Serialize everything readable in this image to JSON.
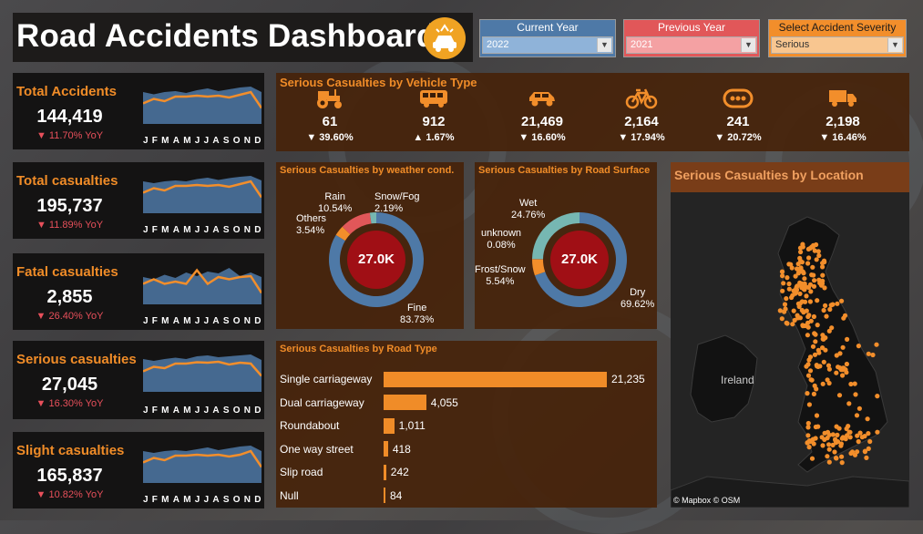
{
  "header": {
    "title": "Road Accidents Dashboard",
    "icon": "car-crash-icon"
  },
  "filters": {
    "current_year": {
      "label": "Current Year",
      "value": "2022",
      "color": "#4e79a7"
    },
    "previous_year": {
      "label": "Previous Year",
      "value": "2021",
      "color": "#e15759"
    },
    "severity": {
      "label": "Select Accident Severity",
      "value": "Serious",
      "color": "#f28e2b"
    }
  },
  "months": [
    "J",
    "F",
    "M",
    "A",
    "M",
    "J",
    "J",
    "A",
    "S",
    "O",
    "N",
    "D"
  ],
  "kpis": [
    {
      "name": "Total Accidents",
      "value": "144,419",
      "yoy": "▼ 11.70% YoY",
      "current": [
        0.45,
        0.55,
        0.5,
        0.6,
        0.6,
        0.62,
        0.6,
        0.62,
        0.58,
        0.64,
        0.7,
        0.35
      ],
      "previous": [
        0.7,
        0.65,
        0.7,
        0.72,
        0.68,
        0.74,
        0.78,
        0.72,
        0.76,
        0.8,
        0.82,
        0.7
      ]
    },
    {
      "name": "Total casualties",
      "value": "195,737",
      "yoy": "▼ 11.89% YoY",
      "current": [
        0.45,
        0.55,
        0.5,
        0.6,
        0.6,
        0.62,
        0.6,
        0.62,
        0.58,
        0.64,
        0.7,
        0.35
      ],
      "previous": [
        0.7,
        0.66,
        0.7,
        0.72,
        0.7,
        0.75,
        0.78,
        0.73,
        0.77,
        0.8,
        0.82,
        0.72
      ]
    },
    {
      "name": "Fatal casualties",
      "value": "2,855",
      "yoy": "▼ 26.40% YoY",
      "current": [
        0.45,
        0.55,
        0.45,
        0.5,
        0.45,
        0.75,
        0.45,
        0.6,
        0.55,
        0.6,
        0.62,
        0.25
      ],
      "previous": [
        0.6,
        0.55,
        0.65,
        0.58,
        0.7,
        0.62,
        0.72,
        0.68,
        0.8,
        0.62,
        0.7,
        0.6
      ]
    },
    {
      "name": "Serious casualties",
      "value": "27,045",
      "yoy": "▼ 16.30% YoY",
      "current": [
        0.45,
        0.55,
        0.52,
        0.62,
        0.62,
        0.65,
        0.64,
        0.66,
        0.6,
        0.64,
        0.62,
        0.35
      ],
      "previous": [
        0.72,
        0.68,
        0.72,
        0.75,
        0.72,
        0.78,
        0.8,
        0.76,
        0.78,
        0.8,
        0.82,
        0.7
      ]
    },
    {
      "name": "Slight casualties",
      "value": "165,837",
      "yoy": "▼ 10.82% YoY",
      "current": [
        0.45,
        0.55,
        0.5,
        0.6,
        0.6,
        0.62,
        0.6,
        0.62,
        0.58,
        0.62,
        0.7,
        0.35
      ],
      "previous": [
        0.7,
        0.66,
        0.7,
        0.72,
        0.7,
        0.74,
        0.78,
        0.72,
        0.76,
        0.8,
        0.82,
        0.7
      ]
    }
  ],
  "vehicle_panel": {
    "title": "Serious Casualties by Vehicle Type",
    "items": [
      {
        "icon": "tractor-icon",
        "value": "61",
        "change": "▼ 39.60%"
      },
      {
        "icon": "bus-icon",
        "value": "912",
        "change": "▲ 1.67%"
      },
      {
        "icon": "car-icon",
        "value": "21,469",
        "change": "▼ 16.60%"
      },
      {
        "icon": "bicycle-icon",
        "value": "2,164",
        "change": "▼ 17.94%"
      },
      {
        "icon": "other-vehicle-icon",
        "value": "241",
        "change": "▼ 20.72%"
      },
      {
        "icon": "truck-icon",
        "value": "2,198",
        "change": "▼ 16.46%"
      }
    ]
  },
  "weather_panel": {
    "title": "Serious Casualties by weather cond.",
    "center": "27.0K",
    "labels": {
      "rain": [
        "Rain",
        "10.54%"
      ],
      "snow": [
        "Snow/Fog",
        "2.19%"
      ],
      "others": [
        "Others",
        "3.54%"
      ],
      "fine": [
        "Fine",
        "83.73%"
      ]
    }
  },
  "surface_panel": {
    "title": "Serious Casualties by Road Surface",
    "center": "27.0K",
    "labels": {
      "wet": [
        "Wet",
        "24.76%"
      ],
      "unknown": [
        "unknown",
        "0.08%"
      ],
      "frost": [
        "Frost/Snow",
        "5.54%"
      ],
      "dry": [
        "Dry",
        "69.62%"
      ]
    }
  },
  "chart_data": [
    {
      "type": "pie",
      "title": "Serious Casualties by weather cond.",
      "categories": [
        "Fine",
        "Others",
        "Rain",
        "Snow/Fog"
      ],
      "values": [
        83.73,
        3.54,
        10.54,
        2.19
      ],
      "colors": [
        "#4e79a7",
        "#f28e2b",
        "#e15759",
        "#76b7b2"
      ]
    },
    {
      "type": "pie",
      "title": "Serious Casualties by Road Surface",
      "categories": [
        "Dry",
        "Frost/Snow",
        "unknown",
        "Wet"
      ],
      "values": [
        69.62,
        5.54,
        0.08,
        24.76
      ],
      "colors": [
        "#4e79a7",
        "#f28e2b",
        "#e15759",
        "#76b7b2"
      ]
    },
    {
      "type": "bar",
      "title": "Serious Casualties by Road Type",
      "categories": [
        "Single carriageway",
        "Dual carriageway",
        "Roundabout",
        "One way street",
        "Slip road",
        "Null"
      ],
      "values": [
        21235,
        4055,
        1011,
        418,
        242,
        84
      ],
      "labels": [
        "21,235",
        "4,055",
        "1,011",
        "418",
        "242",
        "84"
      ]
    }
  ],
  "map_panel": {
    "title": "Serious Casualties by Location",
    "ireland": "Ireland",
    "attribution": "© Mapbox © OSM"
  }
}
